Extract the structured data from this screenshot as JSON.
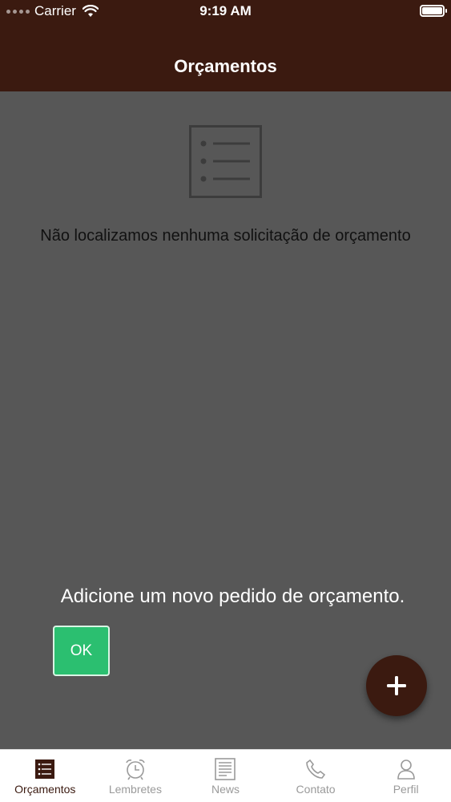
{
  "status_bar": {
    "carrier": "Carrier",
    "time": "9:19 AM"
  },
  "header": {
    "title": "Orçamentos"
  },
  "empty_state": {
    "icon": "list-icon",
    "message": "Não localizamos nenhuma solicitação de orçamento"
  },
  "coach_mark": {
    "message": "Adicione um novo pedido de orçamento.",
    "ok_label": "OK"
  },
  "fab": {
    "icon": "plus-icon"
  },
  "tabs": [
    {
      "label": "Orçamentos",
      "icon": "list-icon",
      "active": true
    },
    {
      "label": "Lembretes",
      "icon": "alarm-clock-icon",
      "active": false
    },
    {
      "label": "News",
      "icon": "newspaper-icon",
      "active": false
    },
    {
      "label": "Contato",
      "icon": "phone-icon",
      "active": false
    },
    {
      "label": "Perfil",
      "icon": "user-icon",
      "active": false
    }
  ],
  "colors": {
    "brand": "#3b1a10",
    "overlay": "#575757",
    "ok_button": "#2bbf70",
    "tab_inactive": "#9a9a9a"
  }
}
